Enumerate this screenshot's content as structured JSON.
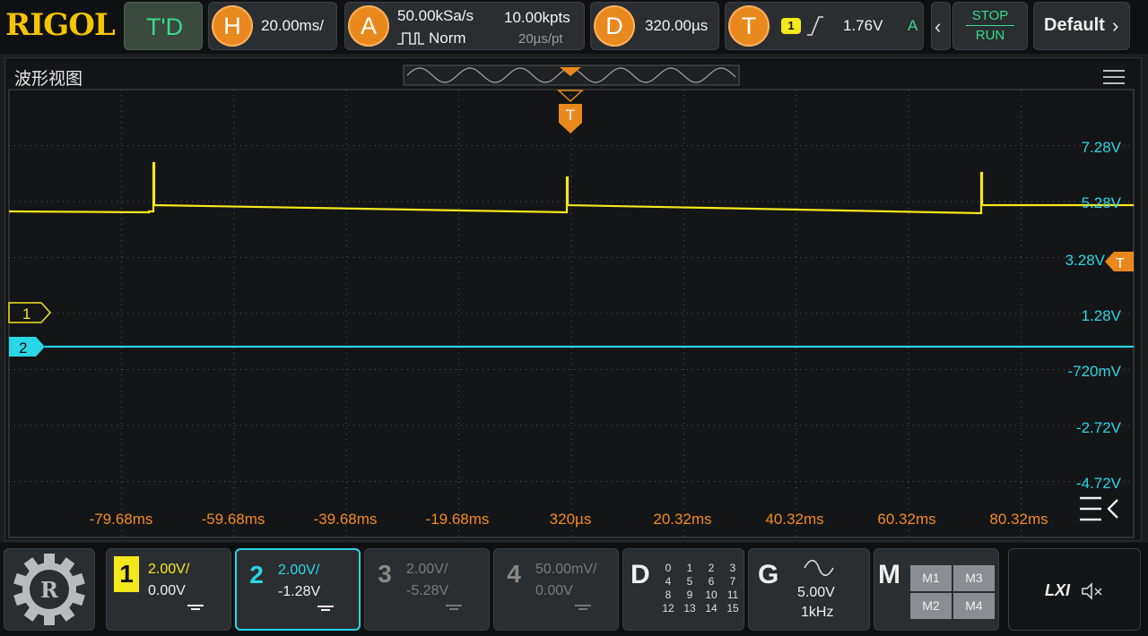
{
  "brand": "RIGOL",
  "top": {
    "mode": "T'D",
    "horizontal": {
      "letter": "H",
      "value": "20.00ms/"
    },
    "acquire": {
      "letter": "A",
      "rate": "50.00kSa/s",
      "mode": "Norm",
      "depth": "10.00kpts",
      "per_pt": "20µs/pt"
    },
    "delay": {
      "letter": "D",
      "value": "320.00µs"
    },
    "trigger": {
      "letter": "T",
      "source": "1",
      "level": "1.76V",
      "sweep": "A"
    },
    "stop": "STOP",
    "run": "RUN",
    "default": "Default"
  },
  "window": {
    "title": "波形视图",
    "trigger_marker": "T",
    "v_labels": [
      "7.28V",
      "5.28V",
      "3.28V",
      "1.28V",
      "-720mV",
      "-2.72V",
      "-4.72V"
    ],
    "t_labels": [
      "-79.68ms",
      "-59.68ms",
      "-39.68ms",
      "-19.68ms",
      "320µs",
      "20.32ms",
      "40.32ms",
      "60.32ms",
      "80.32ms"
    ],
    "ch1_marker": "1",
    "ch2_marker": "2",
    "trig_level_marker": "T"
  },
  "channels": [
    {
      "num": "1",
      "scale": "2.00V/",
      "offset": "0.00V",
      "color": "#f4e81c",
      "active": true
    },
    {
      "num": "2",
      "scale": "2.00V/",
      "offset": "-1.28V",
      "color": "#2ad6e6",
      "active": true,
      "selected": true
    },
    {
      "num": "3",
      "scale": "2.00V/",
      "offset": "-5.28V",
      "color": "#7a7a7a",
      "active": false
    },
    {
      "num": "4",
      "scale": "50.00mV/",
      "offset": "0.00V",
      "color": "#7a7a7a",
      "active": false
    }
  ],
  "digital": {
    "letter": "D",
    "channels": [
      "0",
      "1",
      "2",
      "3",
      "4",
      "5",
      "6",
      "7",
      "8",
      "9",
      "10",
      "11",
      "12",
      "13",
      "14",
      "15"
    ]
  },
  "generator": {
    "letter": "G",
    "amplitude": "5.00V",
    "frequency": "1kHz"
  },
  "math": {
    "letter": "M",
    "items": [
      "M1",
      "M3",
      "M2",
      "M4"
    ]
  },
  "status": {
    "lxi": "LXI"
  },
  "colors": {
    "ch1": "#f4e81c",
    "ch2": "#2ad6e6",
    "accent": "#e9891d",
    "grid": "#5a5d60"
  }
}
